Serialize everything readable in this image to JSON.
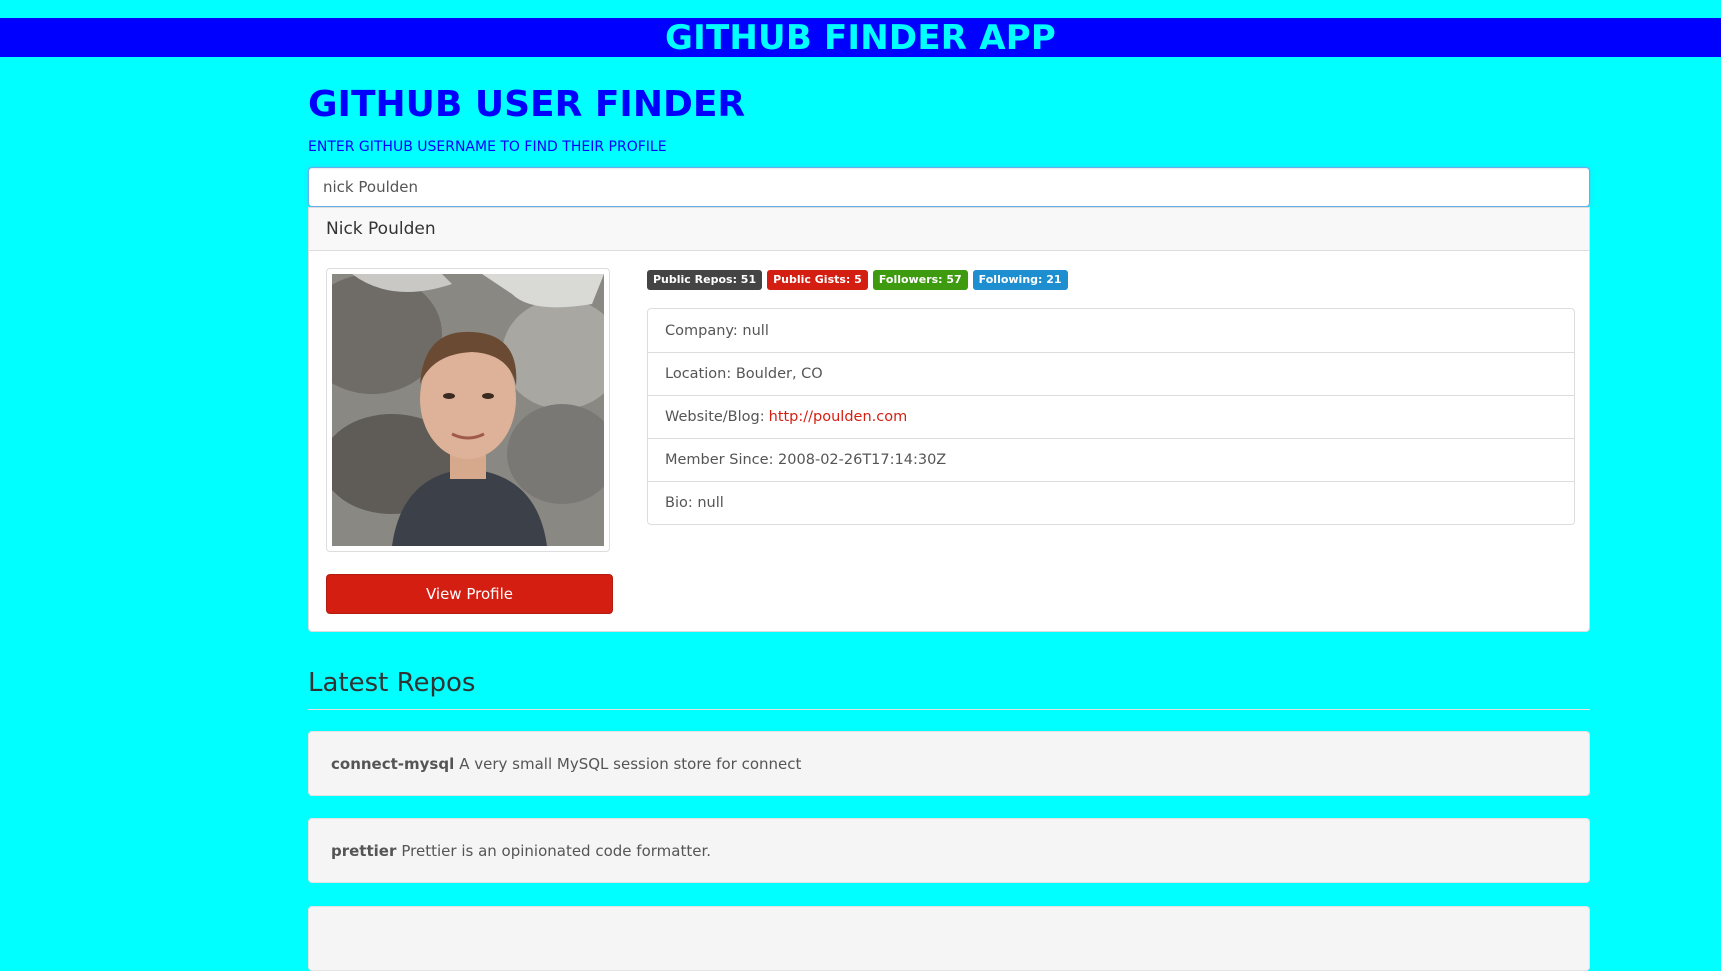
{
  "app": {
    "title": "GITHUB FINDER APP"
  },
  "finder": {
    "title": "GITHUB USER FINDER",
    "subtitle": "ENTER GITHUB USERNAME TO FIND THEIR PROFILE",
    "search_value": "nick Poulden"
  },
  "profile": {
    "name": "Nick Poulden",
    "view_profile_label": "View Profile",
    "badges": [
      {
        "label": "Public Repos: 51",
        "color": "#444444"
      },
      {
        "label": "Public Gists: 5",
        "color": "#d51e12"
      },
      {
        "label": "Followers: 57",
        "color": "#3e9a0f"
      },
      {
        "label": "Following: 21",
        "color": "#1d8fd1"
      }
    ],
    "info": {
      "company": "Company: null",
      "location": "Location: Boulder, CO",
      "website_label": "Website/Blog:",
      "website_url": "http://poulden.com",
      "member_since": "Member Since: 2008-02-26T17:14:30Z",
      "bio": "Bio: null"
    }
  },
  "repos": {
    "title": "Latest Repos",
    "items": [
      {
        "name": "connect-mysql",
        "description": "A very small MySQL session store for connect"
      },
      {
        "name": "prettier",
        "description": "Prettier is an opinionated code formatter."
      }
    ]
  }
}
